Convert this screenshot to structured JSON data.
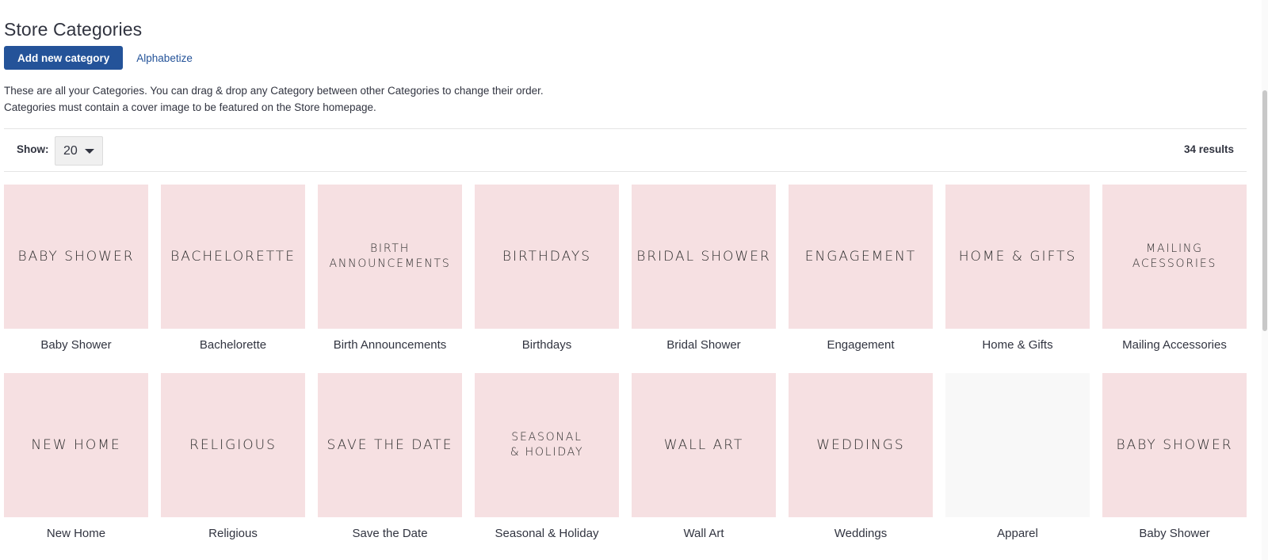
{
  "header": {
    "title": "Store Categories",
    "add_button_label": "Add new category",
    "alphabetize_label": "Alphabetize"
  },
  "description": {
    "line1": "These are all your Categories. You can drag & drop any Category between other Categories to change their order.",
    "line2": "Categories must contain a cover image to be featured on the Store homepage."
  },
  "toolbar": {
    "show_label": "Show:",
    "page_size": "20",
    "results": "34 results"
  },
  "colors": {
    "primary": "#245399",
    "tile_pink": "#f6e0e2",
    "tile_empty": "#f8f8f8"
  },
  "categories": [
    {
      "name": "Baby Shower",
      "tile_text": "BABY SHOWER"
    },
    {
      "name": "Bachelorette",
      "tile_text": "BACHELORETTE"
    },
    {
      "name": "Birth Announcements",
      "tile_text": "BIRTH\nANNOUNCEMENTS"
    },
    {
      "name": "Birthdays",
      "tile_text": "BIRTHDAYS"
    },
    {
      "name": "Bridal Shower",
      "tile_text": "BRIDAL SHOWER"
    },
    {
      "name": "Engagement",
      "tile_text": "ENGAGEMENT"
    },
    {
      "name": "Home & Gifts",
      "tile_text": "HOME & GIFTS"
    },
    {
      "name": "Mailing Accessories",
      "tile_text": "MAILING\nACESSORIES"
    },
    {
      "name": "New Home",
      "tile_text": "NEW HOME"
    },
    {
      "name": "Religious",
      "tile_text": "RELIGIOUS"
    },
    {
      "name": "Save the Date",
      "tile_text": "SAVE THE DATE"
    },
    {
      "name": "Seasonal & Holiday",
      "tile_text": "SEASONAL\n& HOLIDAY"
    },
    {
      "name": "Wall Art",
      "tile_text": "WALL ART"
    },
    {
      "name": "Weddings",
      "tile_text": "WEDDINGS"
    },
    {
      "name": "Apparel",
      "tile_text": ""
    },
    {
      "name": "Baby Shower",
      "tile_text": "BABY SHOWER"
    }
  ]
}
